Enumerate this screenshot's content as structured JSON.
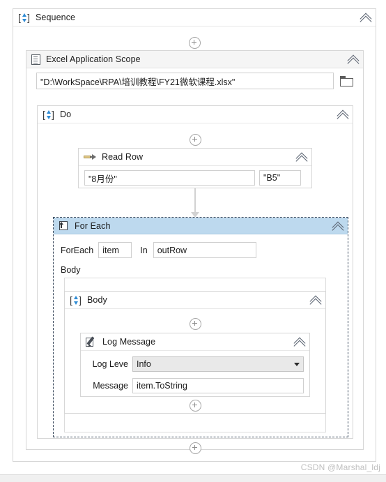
{
  "sequence": {
    "title": "Sequence",
    "icon": "sequence-icon",
    "collapse_label": "«"
  },
  "excel_scope": {
    "title": "Excel Application Scope",
    "icon": "document-icon",
    "workbook_path": "\"D:\\WorkSpace\\RPA\\培训教程\\FY21微软课程.xlsx\"",
    "browse_icon": "folder-icon"
  },
  "do_block": {
    "title": "Do",
    "icon": "sequence-icon"
  },
  "read_row": {
    "title": "Read Row",
    "icon": "arrow-right-icon",
    "sheet_name": "\"8月份\"",
    "range": "\"B5\""
  },
  "for_each": {
    "title": "For Each",
    "icon": "loop-icon",
    "foreach_label": "ForEach",
    "item_value": "item",
    "in_label": "In",
    "collection_value": "outRow",
    "body_label": "Body",
    "selected": true
  },
  "body_block": {
    "title": "Body",
    "icon": "sequence-icon"
  },
  "log_message": {
    "title": "Log Message",
    "icon": "pencil-icon",
    "log_level_label": "Log Leve",
    "log_level_value": "Info",
    "message_label": "Message",
    "message_value": "item.ToString"
  },
  "add_buttons": {
    "label": "+",
    "name": "add-activity-button"
  },
  "watermark": {
    "text": "CSDN @Marshal_ldj"
  },
  "colors": {
    "selection_header": "#bdd9ee",
    "selection_border": "#3c4b5e",
    "card_border": "#d6d6d6",
    "header_bg": "#f5f5f5",
    "field_border": "#cfcfcf",
    "dropdown_bg": "#e9e9e9",
    "connector": "#d2d2d2",
    "watermark": "#bfbfbf"
  }
}
